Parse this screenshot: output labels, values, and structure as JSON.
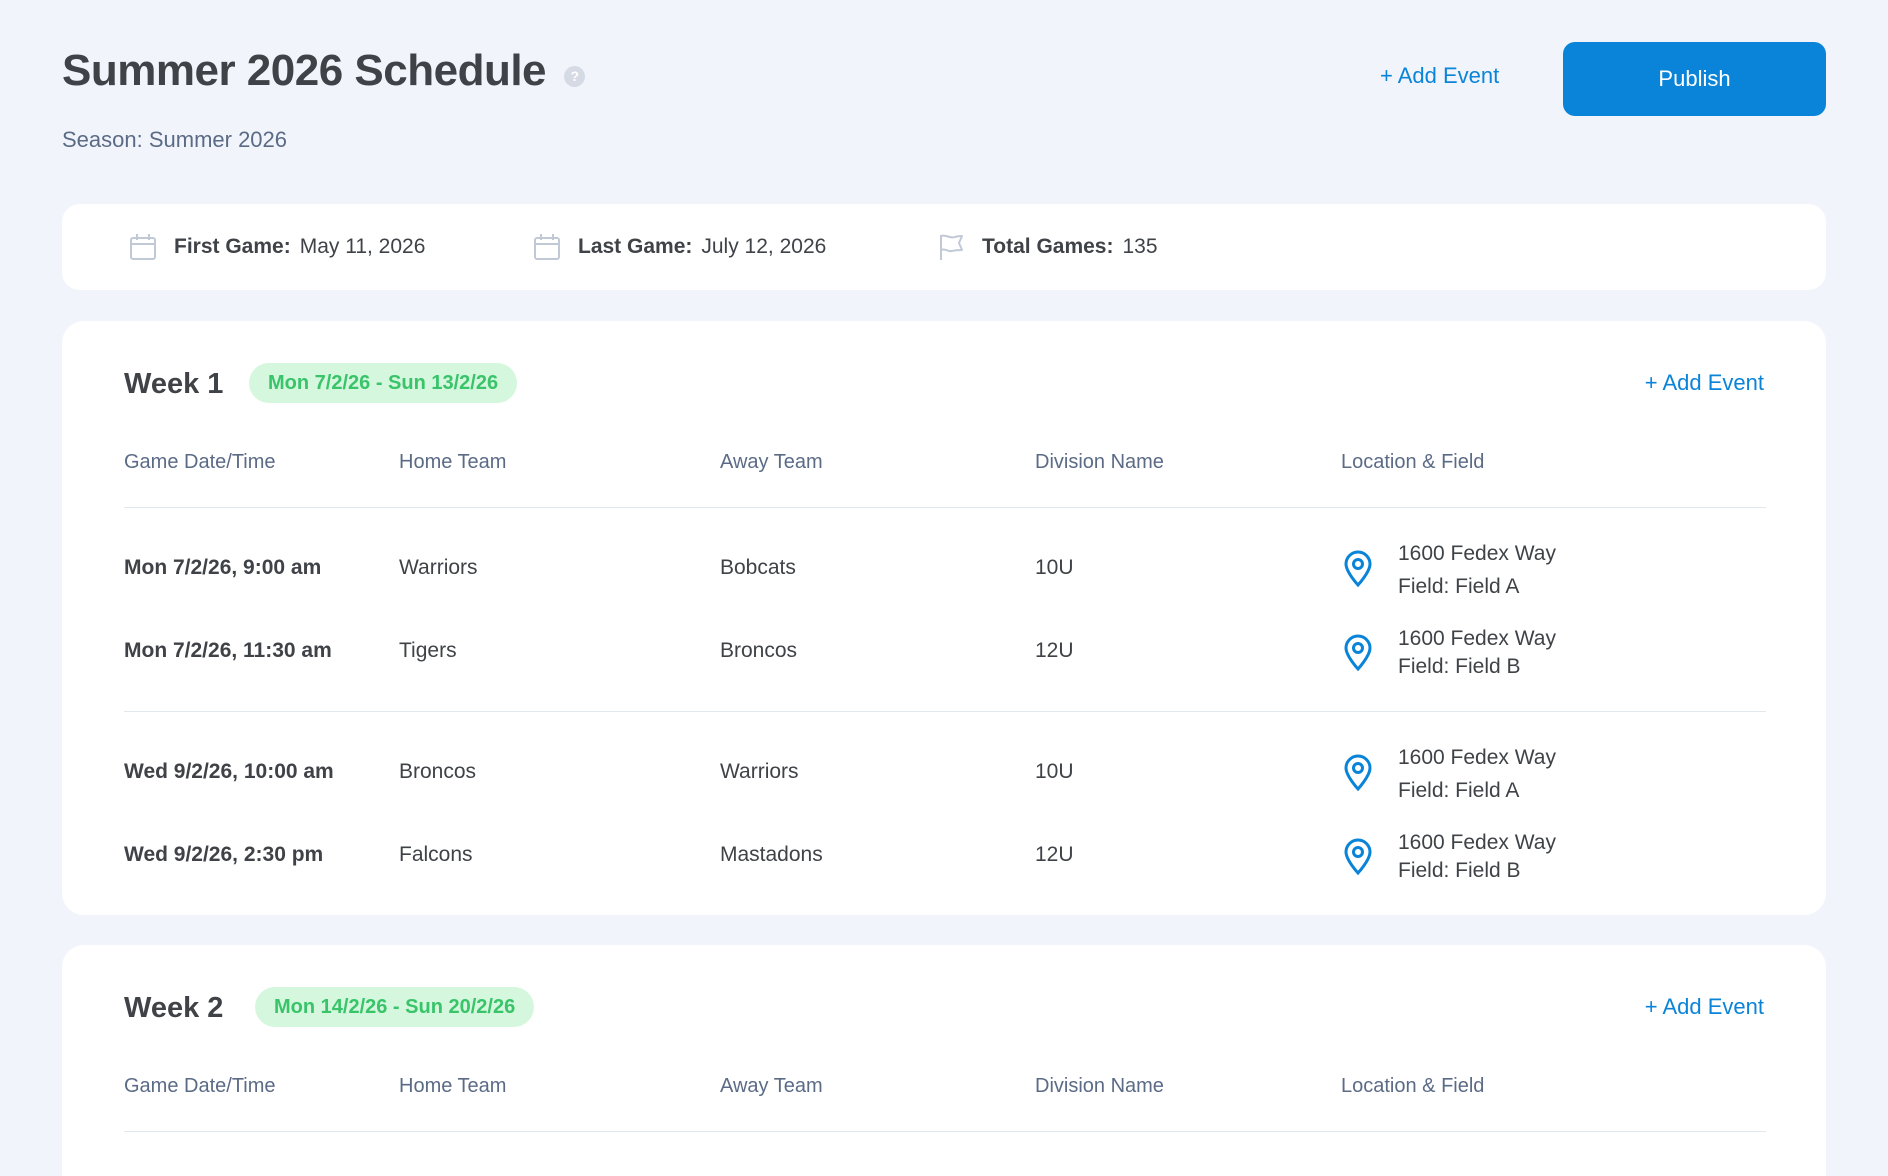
{
  "header": {
    "title": "Summer 2026 Schedule",
    "help_icon": "?",
    "season": "Season: Summer 2026",
    "add_event_label": "+ Add Event",
    "publish_label": "Publish"
  },
  "summary": {
    "first_game_label": "First Game:",
    "first_game_value": "May 11, 2026",
    "last_game_label": "Last Game:",
    "last_game_value": "July 12, 2026",
    "total_games_label": "Total Games:",
    "total_games_value": "135",
    "icons": [
      "calendar-icon",
      "calendar-icon",
      "flag-icon"
    ]
  },
  "columns": [
    "Game Date/Time",
    "Home Team",
    "Away Team",
    "Division Name",
    "Location & Field"
  ],
  "weeks": [
    {
      "title": "Week 1",
      "range": "Mon 7/2/26 - Sun 13/2/26",
      "add_event_label": "+ Add Event",
      "games": [
        {
          "date": "Mon 7/2/26, 9:00 am",
          "home": "Warriors",
          "away": "Bobcats",
          "division": "10U",
          "address": "1600 Fedex Way",
          "field": "Field: Field A"
        },
        {
          "date": "Mon 7/2/26, 11:30 am",
          "home": "Tigers",
          "away": "Broncos",
          "division": "12U",
          "address": "1600 Fedex Way",
          "field": "Field: Field B"
        },
        {
          "date": "Wed 9/2/26, 10:00 am",
          "home": "Broncos",
          "away": "Warriors",
          "division": "10U",
          "address": "1600 Fedex Way",
          "field": "Field: Field A"
        },
        {
          "date": "Wed 9/2/26, 2:30 pm",
          "home": "Falcons",
          "away": "Mastadons",
          "division": "12U",
          "address": "1600 Fedex Way",
          "field": "Field: Field B"
        }
      ]
    },
    {
      "title": "Week 2",
      "range": "Mon 14/2/26 - Sun 20/2/26",
      "add_event_label": "+ Add Event",
      "games": []
    }
  ],
  "colors": {
    "accent": "#0a84d8",
    "badge_bg": "#d4f7de",
    "badge_text": "#39c46a",
    "page_bg": "#f1f5fb"
  }
}
